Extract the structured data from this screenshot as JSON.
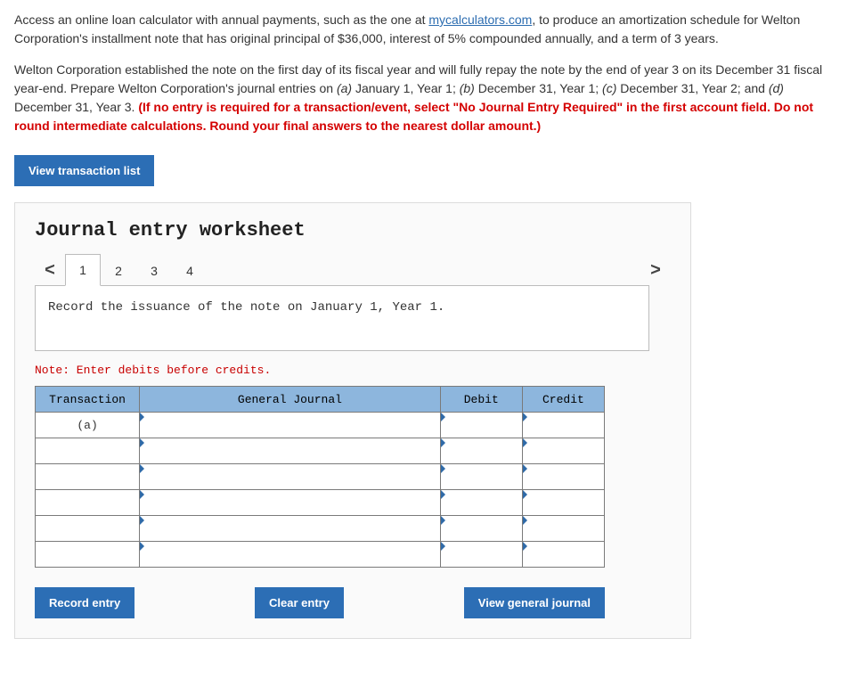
{
  "intro": {
    "p1_before_link": "Access an online loan calculator with annual payments, such as the one at ",
    "link_text": "mycalculators.com",
    "p1_after_link": ", to produce an amortization schedule for Welton Corporation's installment note that has original principal of $36,000, interest of 5% compounded annually, and a term of 3 years.",
    "p2_plain": "Welton Corporation established the note on the first day of its fiscal year and will fully repay the note by the end of year 3 on its December 31 fiscal year-end.  Prepare Welton Corporation's journal entries on ",
    "p2_a": "(a)",
    "p2_a_after": " January 1, Year 1; ",
    "p2_b": "(b)",
    "p2_b_after": " December 31, Year 1; ",
    "p2_c": "(c)",
    "p2_c_after": " December 31, Year 2; and ",
    "p2_d": "(d)",
    "p2_d_after": " December 31, Year 3. ",
    "p2_red": "(If no entry is required for a transaction/event, select \"No Journal Entry Required\" in the first account field. Do not round intermediate calculations. Round your final answers to the nearest dollar amount.)"
  },
  "buttons": {
    "view_list": "View transaction list",
    "record": "Record entry",
    "clear": "Clear entry",
    "view_journal": "View general journal"
  },
  "worksheet": {
    "title": "Journal entry worksheet",
    "tabs": [
      "1",
      "2",
      "3",
      "4"
    ],
    "active_tab": "1",
    "instruction": "Record the issuance of the note on January 1, Year 1.",
    "note": "Note: Enter debits before credits.",
    "headers": {
      "transaction": "Transaction",
      "general_journal": "General Journal",
      "debit": "Debit",
      "credit": "Credit"
    },
    "rows": [
      {
        "txn": "(a)",
        "gj": "",
        "debit": "",
        "credit": ""
      },
      {
        "txn": "",
        "gj": "",
        "debit": "",
        "credit": ""
      },
      {
        "txn": "",
        "gj": "",
        "debit": "",
        "credit": ""
      },
      {
        "txn": "",
        "gj": "",
        "debit": "",
        "credit": ""
      },
      {
        "txn": "",
        "gj": "",
        "debit": "",
        "credit": ""
      },
      {
        "txn": "",
        "gj": "",
        "debit": "",
        "credit": ""
      }
    ]
  },
  "nav": {
    "prev": "<",
    "next": ">"
  }
}
